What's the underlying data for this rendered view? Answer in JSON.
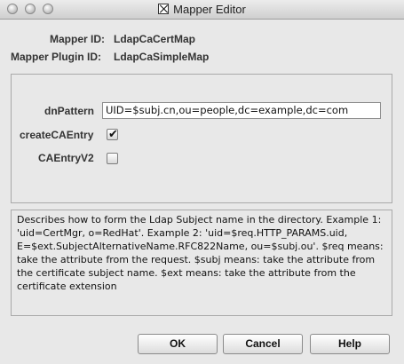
{
  "window": {
    "title": "Mapper Editor"
  },
  "mapper": {
    "id_label": "Mapper ID:",
    "id_value": "LdapCaCertMap",
    "plugin_label": "Mapper Plugin ID:",
    "plugin_value": "LdapCaSimpleMap"
  },
  "form": {
    "dnpattern_label": "dnPattern",
    "dnpattern_value": "UID=$subj.cn,ou=people,dc=example,dc=com",
    "createcaentry_label": "createCAEntry",
    "createcaentry_checked": true,
    "caentryv2_label": "CAEntryV2",
    "caentryv2_checked": false
  },
  "description": "Describes how to form the Ldap Subject name in the directory. Example 1: 'uid=CertMgr, o=RedHat'. Example 2: 'uid=$req.HTTP_PARAMS.uid, E=$ext.SubjectAlternativeName.RFC822Name, ou=$subj.ou'. $req means: take the attribute from the request. $subj means: take the attribute from the certificate subject name. $ext means: take the attribute from the certificate extension",
  "buttons": {
    "ok": "OK",
    "cancel": "Cancel",
    "help": "Help"
  },
  "checkmark_glyph": "✔"
}
